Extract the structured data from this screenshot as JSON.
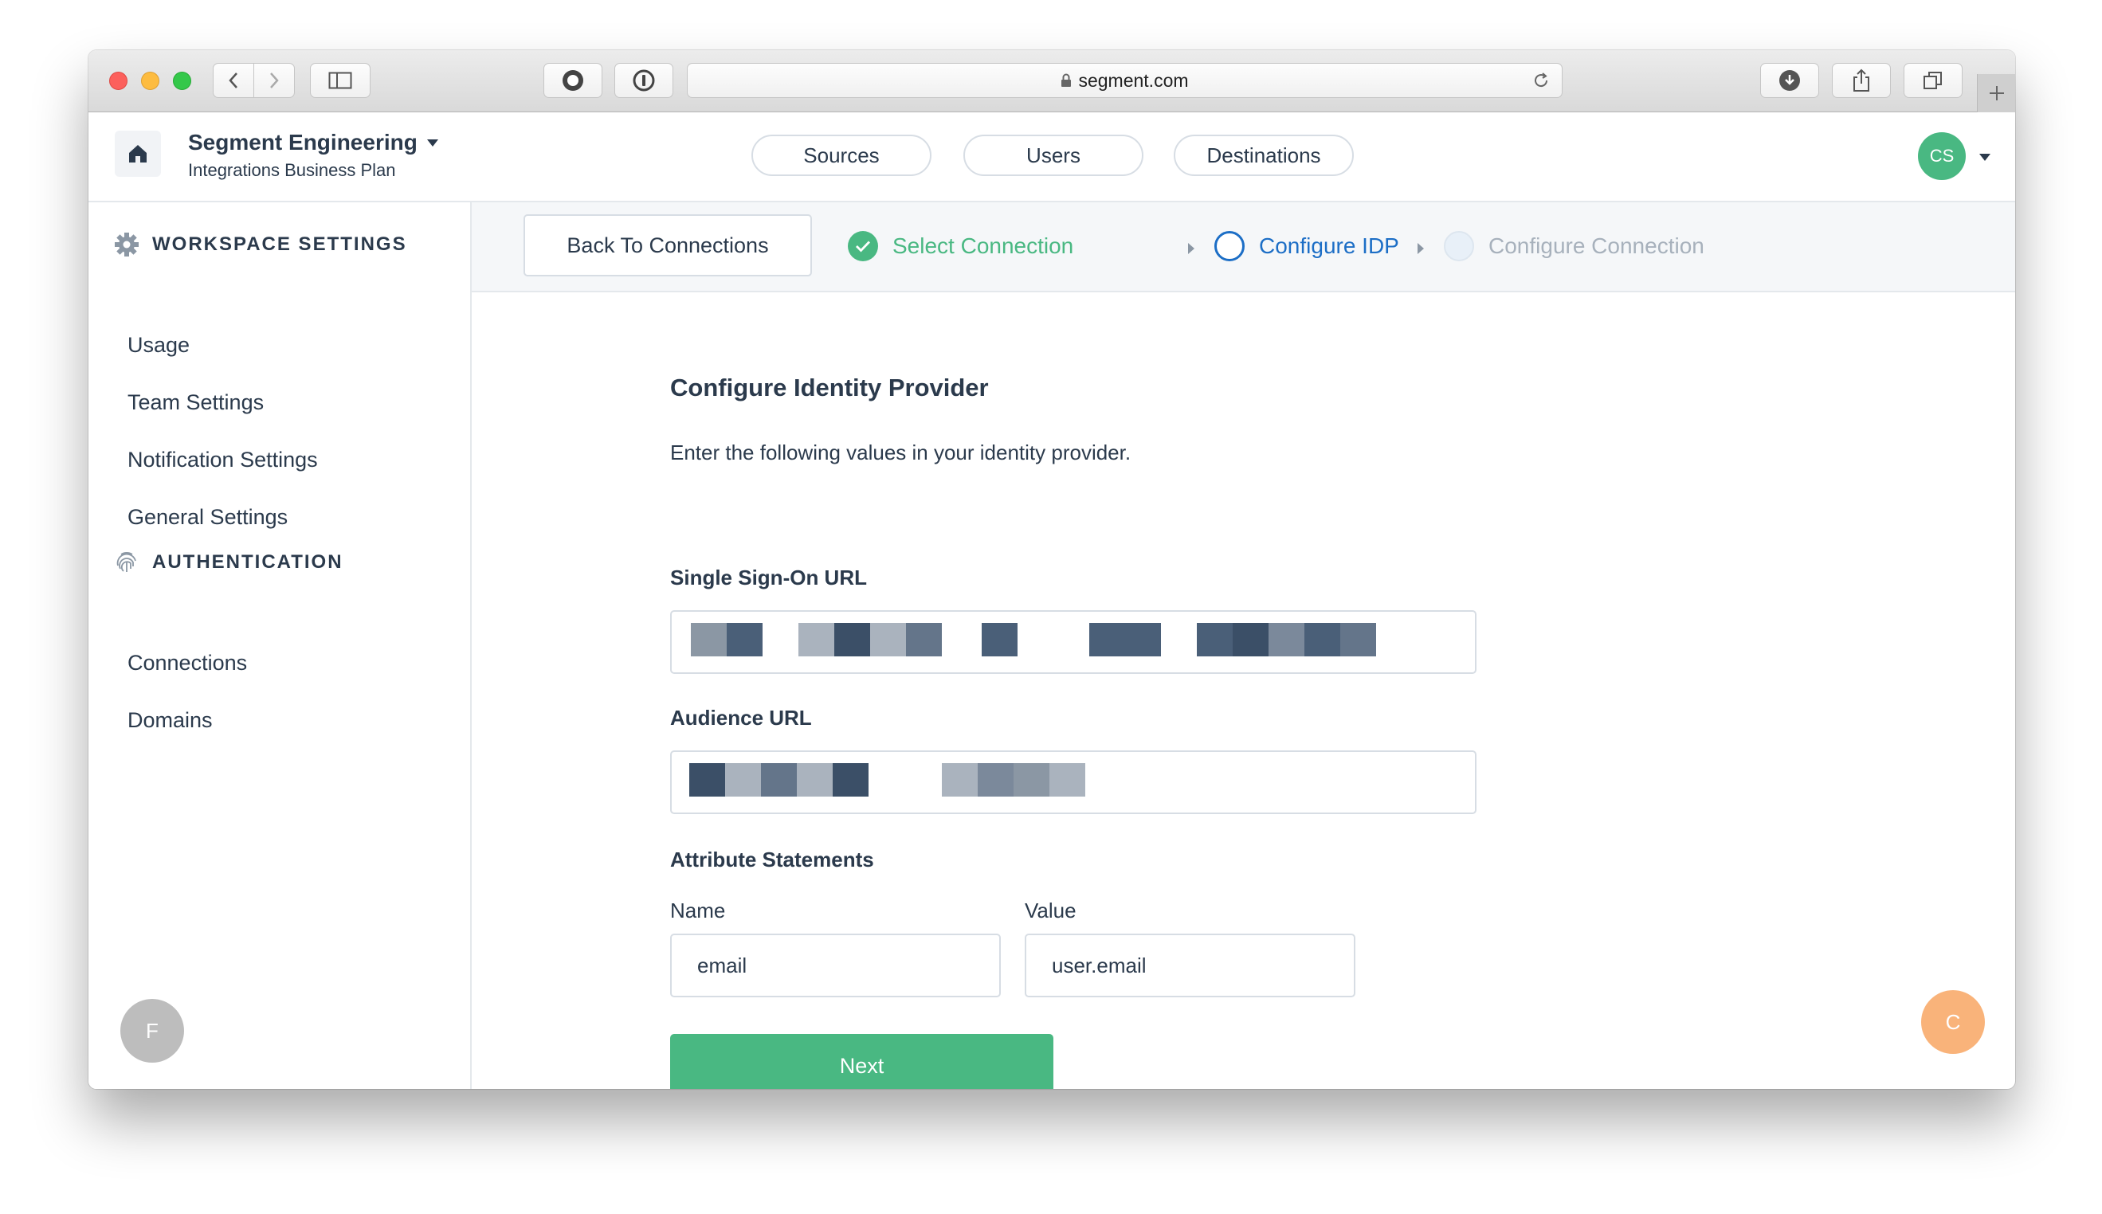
{
  "browser": {
    "url": "segment.com"
  },
  "header": {
    "workspace_name": "Segment Engineering",
    "workspace_plan": "Integrations Business Plan",
    "nav": [
      {
        "label": "Sources"
      },
      {
        "label": "Users"
      },
      {
        "label": "Destinations"
      }
    ],
    "user_initials": "CS",
    "avatar_color": "#49b882"
  },
  "sidebar": {
    "workspace_heading": "WORKSPACE SETTINGS",
    "workspace_items": [
      {
        "label": "Usage"
      },
      {
        "label": "Team Settings"
      },
      {
        "label": "Notification Settings"
      },
      {
        "label": "General Settings"
      }
    ],
    "auth_heading": "AUTHENTICATION",
    "auth_items": [
      {
        "label": "Connections"
      },
      {
        "label": "Domains"
      }
    ],
    "bottom_avatar": "F"
  },
  "stepper": {
    "back_label": "Back To Connections",
    "steps": [
      {
        "label": "Select Connection",
        "state": "done"
      },
      {
        "label": "Configure IDP",
        "state": "active"
      },
      {
        "label": "Configure Connection",
        "state": "pending"
      }
    ]
  },
  "form": {
    "title": "Configure Identity Provider",
    "description": "Enter the following values in your identity provider.",
    "sso_label": "Single Sign-On URL",
    "audience_label": "Audience URL",
    "attributes_label": "Attribute Statements",
    "name_label": "Name",
    "value_label": "Value",
    "name_value": "email",
    "value_value": "user.email",
    "next_label": "Next"
  },
  "chat_avatar": "C",
  "colors": {
    "accent_green": "#49b882",
    "active_blue": "#1c6ec6",
    "text_dark": "#2b3a4c",
    "chat_orange": "#f9b37a"
  }
}
